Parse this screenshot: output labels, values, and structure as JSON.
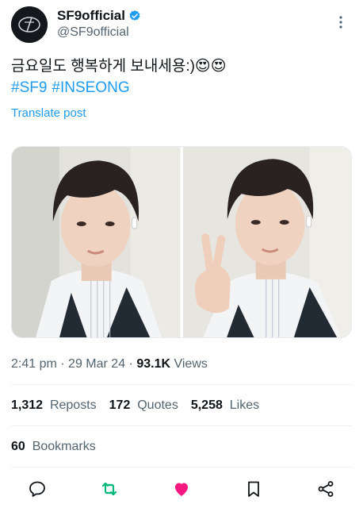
{
  "author": {
    "display_name": "SF9official",
    "handle": "@SF9official",
    "verified": true
  },
  "tweet": {
    "text": "금요일도 행복하게 보내세용:)😍😍",
    "hashtags": [
      "#SF9",
      "#INSEONG"
    ],
    "translate_label": "Translate post"
  },
  "media": [
    {
      "name": "photo-1",
      "alt": ""
    },
    {
      "name": "photo-2",
      "alt": ""
    }
  ],
  "meta": {
    "time": "2:41 pm",
    "date": "29 Mar 24",
    "separator": "·",
    "views_count": "93.1K",
    "views_label": "Views"
  },
  "stats": {
    "reposts_count": "1,312",
    "reposts_label": "Reposts",
    "quotes_count": "172",
    "quotes_label": "Quotes",
    "likes_count": "5,258",
    "likes_label": "Likes",
    "bookmarks_count": "60",
    "bookmarks_label": "Bookmarks"
  },
  "icons": {
    "verified": "verified-badge-icon",
    "more": "more-vertical-icon",
    "reply": "reply-icon",
    "repost": "repost-icon",
    "like": "heart-icon",
    "bookmark": "bookmark-icon",
    "share": "share-icon"
  },
  "colors": {
    "accent": "#1d9bf0",
    "repost_active": "#00ba7c",
    "like_active": "#f91880",
    "text_primary": "#0f1419",
    "text_secondary": "#536471"
  }
}
